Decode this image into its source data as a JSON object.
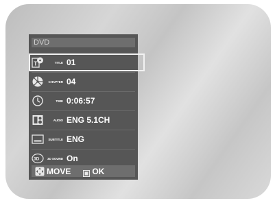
{
  "menu": {
    "header": "DVD",
    "rows": [
      {
        "label": "TITLE",
        "value": "01",
        "icon": "title-icon"
      },
      {
        "label": "CHAPTER",
        "value": "04",
        "icon": "chapter-icon"
      },
      {
        "label": "TIME",
        "value": "0:06:57",
        "icon": "time-icon"
      },
      {
        "label": "AUDIO",
        "value": "ENG 5.1CH",
        "icon": "audio-icon"
      },
      {
        "label": "SUBTITLE",
        "value": "ENG",
        "icon": "subtitle-icon"
      },
      {
        "label": "3D SOUND",
        "value": "On",
        "icon": "3d-sound-icon"
      }
    ],
    "selected_index": 0,
    "footer": {
      "move_label": "MOVE",
      "ok_label": "OK"
    }
  }
}
